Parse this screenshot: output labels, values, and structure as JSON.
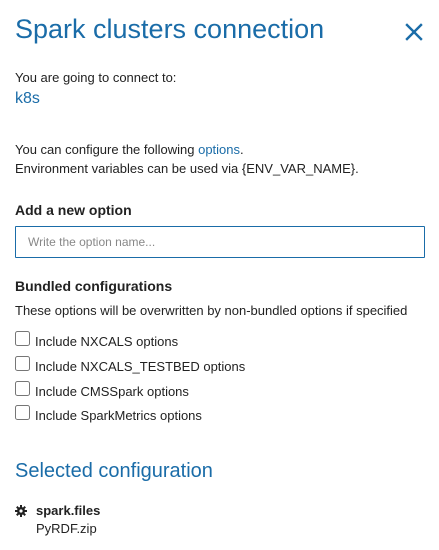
{
  "dialog": {
    "title": "Spark clusters connection",
    "close_icon": "close-icon",
    "accent_color": "#1a6ca8"
  },
  "connection": {
    "label": "You are going to connect to:",
    "target": "k8s"
  },
  "configure": {
    "prefix": "You can configure the following ",
    "link": "options",
    "suffix": ".",
    "env_note": "Environment variables can be used via {ENV_VAR_NAME}."
  },
  "add_option": {
    "heading": "Add a new option",
    "placeholder": "Write the option name...",
    "value": ""
  },
  "bundled": {
    "heading": "Bundled configurations",
    "note": "These options will be overwritten by non-bundled options if specified",
    "items": [
      {
        "label": "Include NXCALS options",
        "checked": false
      },
      {
        "label": "Include NXCALS_TESTBED options",
        "checked": false
      },
      {
        "label": "Include CMSSpark options",
        "checked": false
      },
      {
        "label": "Include SparkMetrics options",
        "checked": false
      }
    ]
  },
  "selected": {
    "heading": "Selected configuration",
    "options": [
      {
        "icon": "gear-icon",
        "key": "spark.files",
        "value": "PyRDF.zip"
      }
    ]
  }
}
